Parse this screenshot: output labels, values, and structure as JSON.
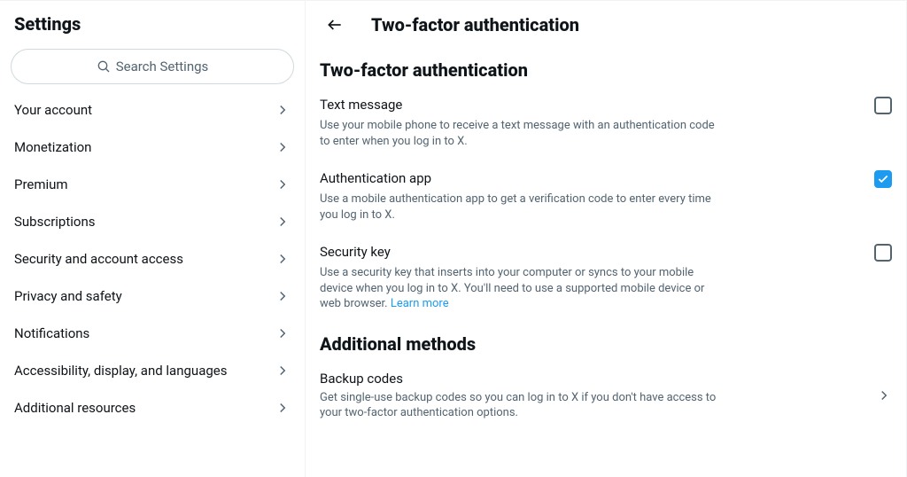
{
  "sidebar": {
    "title": "Settings",
    "search_placeholder": "Search Settings",
    "items": [
      {
        "label": "Your account"
      },
      {
        "label": "Monetization"
      },
      {
        "label": "Premium"
      },
      {
        "label": "Subscriptions"
      },
      {
        "label": "Security and account access"
      },
      {
        "label": "Privacy and safety"
      },
      {
        "label": "Notifications"
      },
      {
        "label": "Accessibility, display, and languages"
      },
      {
        "label": "Additional resources"
      }
    ]
  },
  "main": {
    "header_title": "Two-factor authentication",
    "section1_title": "Two-factor authentication",
    "options": [
      {
        "label": "Text message",
        "desc": "Use your mobile phone to receive a text message with an authentication code to enter when you log in to X.",
        "checked": false
      },
      {
        "label": "Authentication app",
        "desc": "Use a mobile authentication app to get a verification code to enter every time you log in to X.",
        "checked": true
      },
      {
        "label": "Security key",
        "desc": "Use a security key that inserts into your computer or syncs to your mobile device when you log in to X. You'll need to use a supported mobile device or web browser. ",
        "learn_more": "Learn more",
        "checked": false
      }
    ],
    "section2_title": "Additional methods",
    "backup": {
      "label": "Backup codes",
      "desc": "Get single-use backup codes so you can log in to X if you don't have access to your two-factor authentication options."
    }
  }
}
